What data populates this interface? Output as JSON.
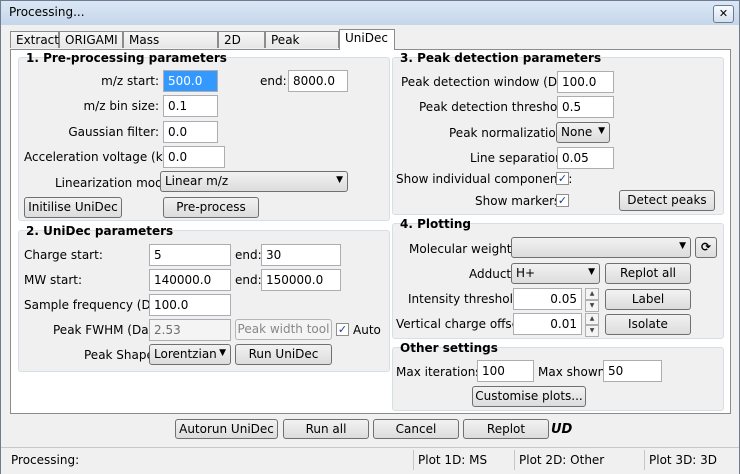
{
  "window": {
    "title": "Processing...",
    "close_icon": "close-icon"
  },
  "tabs": [
    {
      "label": "Extract"
    },
    {
      "label": "ORIGAMI"
    },
    {
      "label": "Mass spectrum"
    },
    {
      "label": "2D"
    },
    {
      "label": "Peak fitting"
    },
    {
      "label": "UniDec",
      "active": true
    }
  ],
  "preprocessing": {
    "title": "1. Pre-processing parameters",
    "mz_start_label": "m/z start:",
    "mz_start": "500.0",
    "end_label": "end:",
    "mz_end": "8000.0",
    "mz_bin_label": "m/z bin size:",
    "mz_bin": "0.1",
    "gauss_label": "Gaussian filter:",
    "gauss": "0.0",
    "accel_label": "Acceleration voltage (kV):",
    "accel": "0.0",
    "linmode_label": "Linearization mode:",
    "linmode": "Linear m/z",
    "init_button": "Initilise UniDec",
    "preprocess_button": "Pre-process"
  },
  "unidec": {
    "title": "2. UniDec parameters",
    "charge_start_label": "Charge start:",
    "charge_start": "5",
    "charge_end_label": "end:",
    "charge_end": "30",
    "mw_start_label": "MW start:",
    "mw_start": "140000.0",
    "mw_end_label": "end:",
    "mw_end": "150000.0",
    "sample_freq_label": "Sample frequency (Da):",
    "sample_freq": "100.0",
    "fwhm_label": "Peak FWHM (Da):",
    "fwhm": "2.53",
    "peak_width_button": "Peak width tool",
    "auto_label": "Auto",
    "auto_checked": true,
    "peak_shape_label": "Peak Shape:",
    "peak_shape": "Lorentzian",
    "run_button": "Run UniDec"
  },
  "peak_detection": {
    "title": "3. Peak detection parameters",
    "window_label": "Peak detection window (Da):",
    "window": "100.0",
    "threshold_label": "Peak detection threshold:",
    "threshold": "0.5",
    "norm_label": "Peak normalization:",
    "norm": "None",
    "line_sep_label": "Line separation:",
    "line_sep": "0.05",
    "show_components_label": "Show individual components:",
    "show_components": true,
    "show_markers_label": "Show markers:",
    "show_markers": true,
    "detect_button": "Detect peaks"
  },
  "plotting": {
    "title": "4. Plotting",
    "mw_label": "Molecular weights:",
    "mw_value": "",
    "adduct_label": "Adduct:",
    "adduct": "H+",
    "replot_all_button": "Replot all",
    "intensity_label": "Intensity threshold:",
    "intensity": "0.05",
    "label_button": "Label",
    "offset_label": "Vertical charge offset:",
    "offset": "0.01",
    "isolate_button": "Isolate"
  },
  "other": {
    "title": "Other settings",
    "max_iter_label": "Max iterations:",
    "max_iter": "100",
    "max_shown_label": "Max shown:",
    "max_shown": "50",
    "customise_button": "Customise plots..."
  },
  "actions": {
    "autorun": "Autorun UniDec",
    "run_all": "Run all",
    "cancel": "Cancel",
    "replot": "Replot",
    "logo": "UD"
  },
  "statusbar": {
    "status": "Processing:",
    "plot1d": "Plot 1D: MS",
    "plot2d": "Plot 2D: Other",
    "plot3d": "Plot 3D: 3D"
  }
}
